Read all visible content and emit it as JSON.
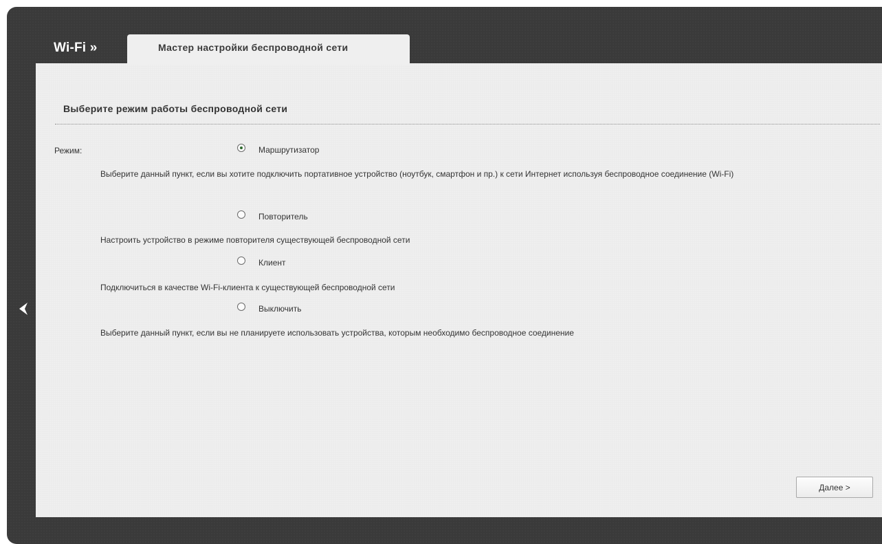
{
  "header": {
    "section": "Wi-Fi »",
    "tab_title": "Мастер настройки беспроводной сети"
  },
  "main": {
    "heading": "Выберите режим работы беспроводной сети",
    "mode_label": "Режим:",
    "options": [
      {
        "label": "Маршрутизатор",
        "checked": true,
        "description": "Выберите данный пункт, если вы хотите подключить портативное устройство (ноутбук, смартфон и пр.) к сети Интернет используя беспроводное соединение (Wi-Fi)"
      },
      {
        "label": "Повторитель",
        "checked": false,
        "description": "Настроить устройство в режиме повторителя существующей беспроводной сети"
      },
      {
        "label": "Клиент",
        "checked": false,
        "description": "Подключиться в качестве Wi-Fi-клиента к существующей беспроводной сети"
      },
      {
        "label": "Выключить",
        "checked": false,
        "description": "Выберите данный пункт, если вы не планируете использовать устройства, которым необходимо беспроводное соединение"
      }
    ],
    "next_button": "Далее >"
  },
  "icons": {
    "back": "chevron-left-icon"
  },
  "colors": {
    "frame": "#3a3a3a",
    "panel": "#efefef",
    "text": "#333333",
    "radio_checked": "#2f6a2f"
  }
}
